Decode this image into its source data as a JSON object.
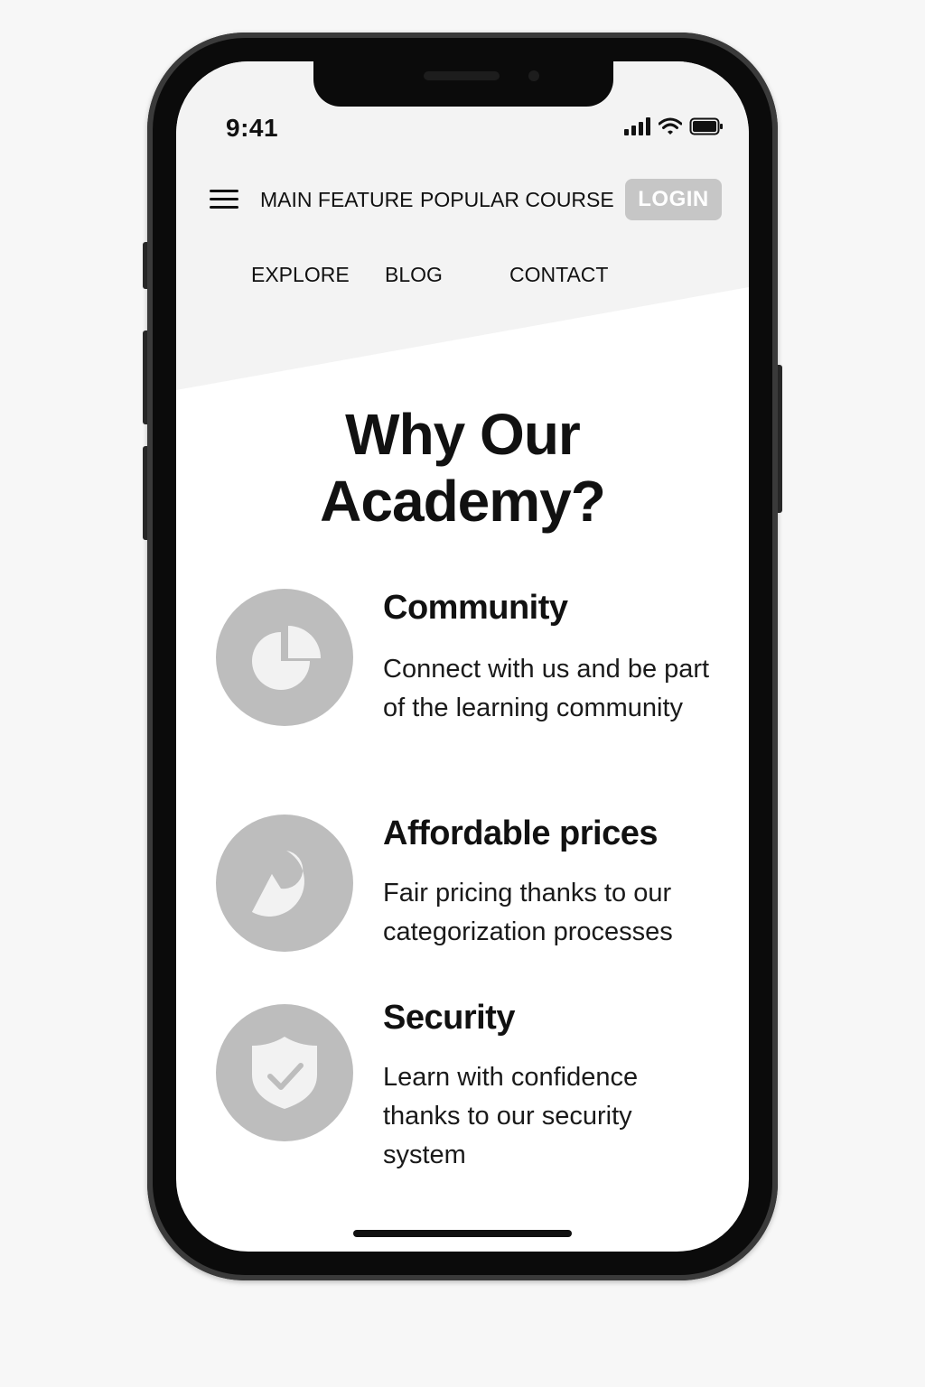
{
  "status_bar": {
    "time": "9:41",
    "icons": [
      "signal-icon",
      "wifi-icon",
      "battery-icon"
    ]
  },
  "nav": {
    "menu_icon": "hamburger-menu-icon",
    "main_feature": "MAIN FEATURE",
    "popular_course": "POPULAR COURSE",
    "login": "LOGIN",
    "explore": "EXPLORE",
    "blog": "BLOG",
    "contact": "CONTACT"
  },
  "hero": {
    "title_line1": "Why Our",
    "title_line2": "Academy?"
  },
  "features": [
    {
      "icon": "pie-chart-icon",
      "title": "Community",
      "description": "Connect with us and be part of the learning community"
    },
    {
      "icon": "price-chart-icon",
      "title": "Affordable prices",
      "description": "Fair pricing thanks to our categorization processes"
    },
    {
      "icon": "shield-check-icon",
      "title": "Security",
      "description": "Learn with confidence thanks to our security system"
    }
  ],
  "colors": {
    "accent_gray": "#bdbdbd",
    "login_bg": "#c6c6c6",
    "header_bg": "#f3f3f3",
    "text": "#111111"
  }
}
